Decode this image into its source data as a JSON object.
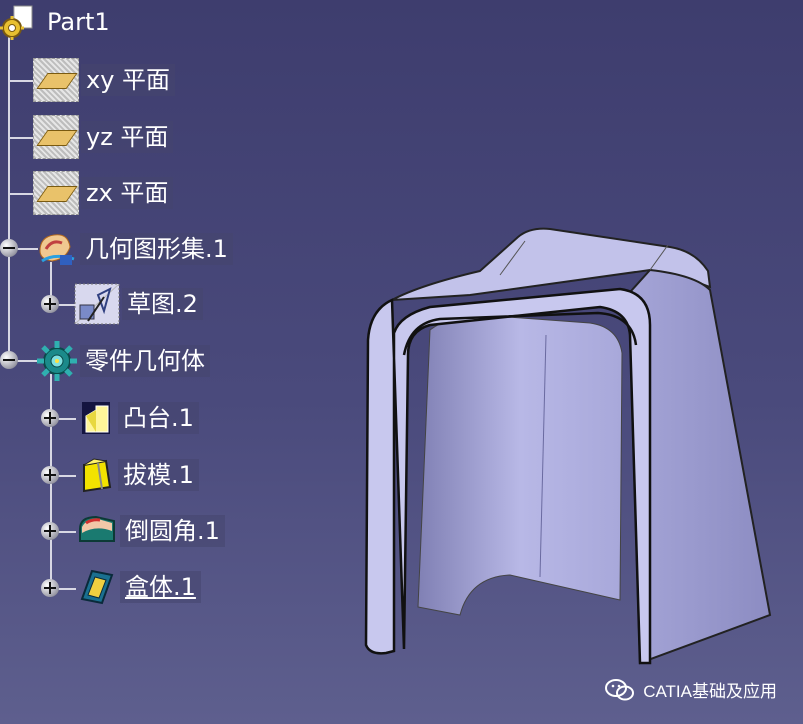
{
  "tree": {
    "root": {
      "label": "Part1",
      "icon": "part-gear-icon"
    },
    "items": [
      {
        "id": "xy",
        "label": "xy 平面",
        "icon": "plane-icon",
        "expander": null
      },
      {
        "id": "yz",
        "label": "yz 平面",
        "icon": "plane-icon",
        "expander": null
      },
      {
        "id": "zx",
        "label": "zx 平面",
        "icon": "plane-icon",
        "expander": null
      },
      {
        "id": "geoset",
        "label": "几何图形集.1",
        "icon": "geometrical-set-icon",
        "expander": "minus"
      },
      {
        "id": "sketch",
        "label": "草图.2",
        "icon": "sketch-icon",
        "expander": "plus"
      },
      {
        "id": "body",
        "label": "零件几何体",
        "icon": "part-body-gear-icon",
        "expander": "minus"
      },
      {
        "id": "pad",
        "label": "凸台.1",
        "icon": "pad-icon",
        "expander": "plus"
      },
      {
        "id": "draft",
        "label": "拔模.1",
        "icon": "draft-icon",
        "expander": "plus"
      },
      {
        "id": "fillet",
        "label": "倒圆角.1",
        "icon": "fillet-icon",
        "expander": "plus"
      },
      {
        "id": "shell",
        "label": "盒体.1",
        "icon": "shell-icon",
        "expander": "plus",
        "selected": true
      }
    ]
  },
  "viewport": {
    "model": "shelled-arch-solid",
    "background": "#4a4a7c",
    "model_color": "#b4b4e0"
  },
  "watermark": {
    "text": "CATIA基础及应用",
    "icon": "wechat-icon"
  }
}
